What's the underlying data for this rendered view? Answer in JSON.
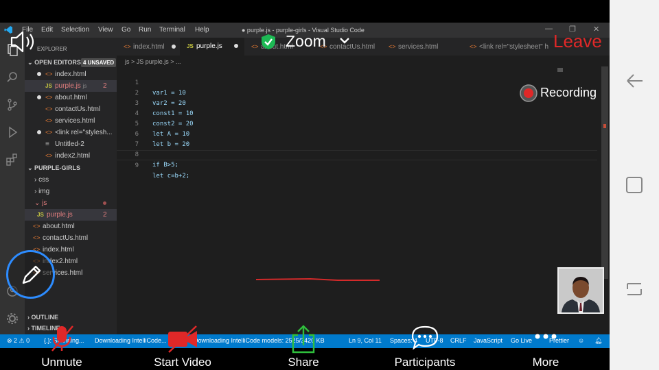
{
  "vscode": {
    "menu": [
      "File",
      "Edit",
      "Selection",
      "View",
      "Go",
      "Run",
      "Terminal",
      "Help"
    ],
    "window_title": "● purple.js - purple-girls - Visual Studio Code",
    "explorer_label": "EXPLORER",
    "open_editors": {
      "header": "OPEN EDITORS",
      "unsaved_badge": "4 UNSAVED",
      "items": [
        {
          "label": "index.html",
          "type": "html",
          "unsaved": true
        },
        {
          "label": "purple.js",
          "type": "js",
          "unsaved": false,
          "suffix": "js",
          "problems": "2"
        },
        {
          "label": "about.html",
          "type": "html",
          "unsaved": true
        },
        {
          "label": "contactUs.html",
          "type": "html",
          "unsaved": false
        },
        {
          "label": "services.html",
          "type": "html",
          "unsaved": false
        },
        {
          "label": "<link rel=\"stylesh...",
          "type": "html",
          "unsaved": true
        },
        {
          "label": "Untitled-2",
          "type": "text",
          "unsaved": false
        },
        {
          "label": "index2.html",
          "type": "html",
          "unsaved": false
        }
      ]
    },
    "project": {
      "header": "PURPLE-GIRLS",
      "items": [
        {
          "label": "css",
          "folder": true
        },
        {
          "label": "img",
          "folder": true
        },
        {
          "label": "js",
          "folder": true,
          "open": true
        },
        {
          "label": "purple.js",
          "type": "js",
          "problems": "2"
        },
        {
          "label": "about.html",
          "type": "html"
        },
        {
          "label": "contactUs.html",
          "type": "html"
        },
        {
          "label": "index.html",
          "type": "html"
        },
        {
          "label": "index2.html",
          "type": "html"
        },
        {
          "label": "services.html",
          "type": "html"
        }
      ]
    },
    "outline": "OUTLINE",
    "timeline": "TIMELINE",
    "tabs": [
      "index.html",
      "purple.js",
      "about.html",
      "contactUs.html",
      "services.html",
      "<link rel=\"stylesheet\" h"
    ],
    "breadcrumb": "js  >  JS purple.js  >  ...",
    "code_lines": [
      {
        "n": "1",
        "text": "var1 = 10"
      },
      {
        "n": "2",
        "text": "var2 = 20"
      },
      {
        "n": "3",
        "text": "const1 = 10"
      },
      {
        "n": "4",
        "text": "const2 = 20"
      },
      {
        "n": "5",
        "text": "let A = 10"
      },
      {
        "n": "6",
        "text": "let b = 20"
      },
      {
        "n": "7",
        "text": ""
      },
      {
        "n": "8",
        "text": "if B>5;"
      },
      {
        "n": "9",
        "text": "let c=b+2;"
      }
    ],
    "status": {
      "errors": "⊗ 2 ⚠ 0",
      "left_task": "{.}: Scanning...",
      "download1": "Downloading IntelliCode...",
      "download2": "Downloading IntelliCode models: 2525/3420 KB",
      "position": "Ln 9, Col 11",
      "spaces": "Spaces: 4",
      "encoding": "UTF-8",
      "eol": "CRLF",
      "language": "JavaScript",
      "golive": "Go Live",
      "prettier": "Prettier"
    }
  },
  "zoom": {
    "title": "Zoom",
    "leave": "Leave",
    "recording": "Recording",
    "toolbar": [
      {
        "label": "Unmute",
        "icon": "mic-muted-icon"
      },
      {
        "label": "Start Video",
        "icon": "video-off-icon"
      },
      {
        "label": "Share",
        "icon": "share-icon"
      },
      {
        "label": "Participants",
        "icon": "participants-icon"
      },
      {
        "label": "More",
        "icon": "more-icon"
      }
    ],
    "colors": {
      "leave": "#e02828",
      "accent": "#2d8cff",
      "share": "#2fbf3c",
      "record": "#e02828"
    }
  }
}
